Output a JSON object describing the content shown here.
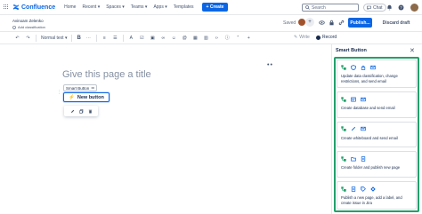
{
  "nav": {
    "brand": "Confluence",
    "items": [
      "Home",
      "Recent ▾",
      "Spaces ▾",
      "Teams ▾",
      "Apps ▾",
      "Templates"
    ],
    "create_label": "+ Create",
    "search_placeholder": "Search",
    "chat_label": "Chat"
  },
  "header": {
    "author": "Avinoam Zelenko",
    "add_classification": "Add classification",
    "saved_label": "Saved",
    "publish_label": "Publish...",
    "discard_label": "Discard draft"
  },
  "toolbar": {
    "text_style": "Normal text ▾",
    "bold": "B",
    "write_label": "Write",
    "record_label": "Record"
  },
  "editor": {
    "title_placeholder": "Give this page a title",
    "smart_tag_label": "Smart Button",
    "new_button_label": "New button"
  },
  "panel": {
    "title": "Smart Button",
    "cards": [
      {
        "text": "Update data classification, change restrictions, and send email",
        "icons": [
          "flow-icon",
          "shield-icon",
          "lock-icon",
          "mail-icon"
        ]
      },
      {
        "text": "Create database and send email",
        "icons": [
          "flow-icon",
          "database-icon",
          "mail-icon"
        ]
      },
      {
        "text": "Create whiteboard and send email",
        "icons": [
          "flow-icon",
          "whiteboard-icon",
          "mail-icon"
        ]
      },
      {
        "text": "Create folder and publish new page",
        "icons": [
          "flow-icon",
          "folder-icon",
          "page-icon"
        ]
      },
      {
        "text": "Publish a new page, add a label, and create issue in Jira",
        "icons": [
          "flow-icon",
          "page-icon",
          "label-icon",
          "jira-icon"
        ]
      }
    ]
  },
  "colors": {
    "brand": "#0c66e4",
    "highlight": "#22a06b",
    "icon_green": "#22a06b",
    "icon_blue": "#0c66e4"
  }
}
